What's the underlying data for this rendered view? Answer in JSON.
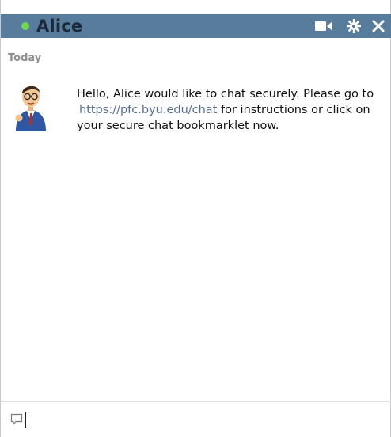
{
  "chat": {
    "contact_name": "Alice",
    "status": "online",
    "status_color": "#6fd84b",
    "title_bar_color": "#587c9c"
  },
  "header_icons": {
    "video": "video-camera-icon",
    "settings": "gear-icon",
    "close": "close-icon"
  },
  "conversation": {
    "day_label": "Today",
    "messages": [
      {
        "avatar": "cartoon-man-with-glasses-avatar",
        "part1": "Hello",
        "part2": ",",
        "part3": "Alice",
        "part4": "would like to chat securely. Please go to",
        "link": "https://pfc.byu.edu/chat",
        "part5": "for instructions or click on your secure chat bookmarklet now."
      }
    ]
  },
  "composer": {
    "icon": "speech-bubble-icon",
    "value": ""
  }
}
